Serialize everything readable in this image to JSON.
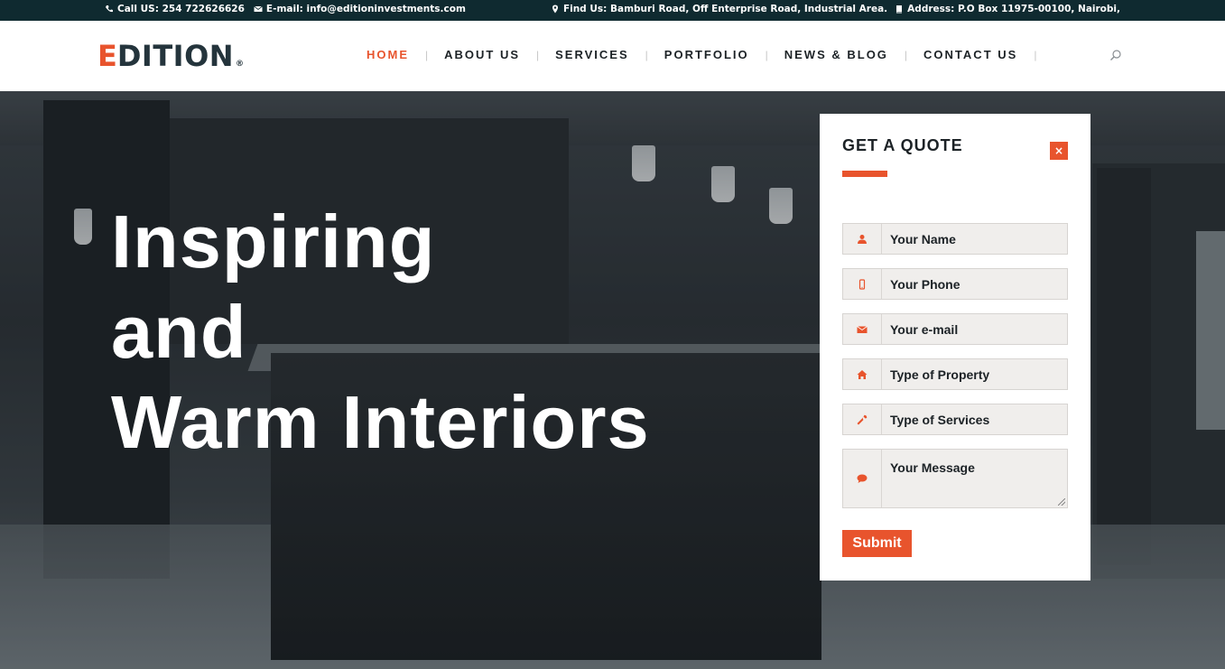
{
  "topbar": {
    "phone": "Call US: 254 722626626",
    "email": "E-mail: info@editioninvestments.com",
    "location": "Find Us: Bamburi Road, Off Enterprise Road, Industrial Area.",
    "address": "Address: P.O Box 11975-00100, Nairobi,"
  },
  "brand": {
    "logo_first": "E",
    "logo_rest": "DITION",
    "registered": "®",
    "accent_color": "#e8542d",
    "dark_color": "#24343c"
  },
  "nav": {
    "items": [
      {
        "label": "HOME",
        "active": true
      },
      {
        "label": "ABOUT US",
        "active": false
      },
      {
        "label": "SERVICES",
        "active": false
      },
      {
        "label": "PORTFOLIO",
        "active": false
      },
      {
        "label": "NEWS & BLOG",
        "active": false
      },
      {
        "label": "CONTACT US",
        "active": false
      }
    ],
    "separator": "|",
    "search_icon": "search-icon"
  },
  "hero": {
    "line1": "Inspiring",
    "line2": "and",
    "line3": "Warm Interiors"
  },
  "quote_form": {
    "title": "GET A QUOTE",
    "close": "×",
    "fields": {
      "name": {
        "placeholder": "Your Name",
        "icon": "user-icon"
      },
      "phone": {
        "placeholder": "Your Phone",
        "icon": "mobile-icon"
      },
      "email": {
        "placeholder": "Your e-mail",
        "icon": "envelope-icon"
      },
      "property": {
        "placeholder": "Type of Property",
        "icon": "home-icon"
      },
      "services": {
        "placeholder": "Type of Services",
        "icon": "wrench-icon"
      },
      "message": {
        "placeholder": "Your Message",
        "icon": "comment-icon"
      }
    },
    "submit": "Submit"
  }
}
